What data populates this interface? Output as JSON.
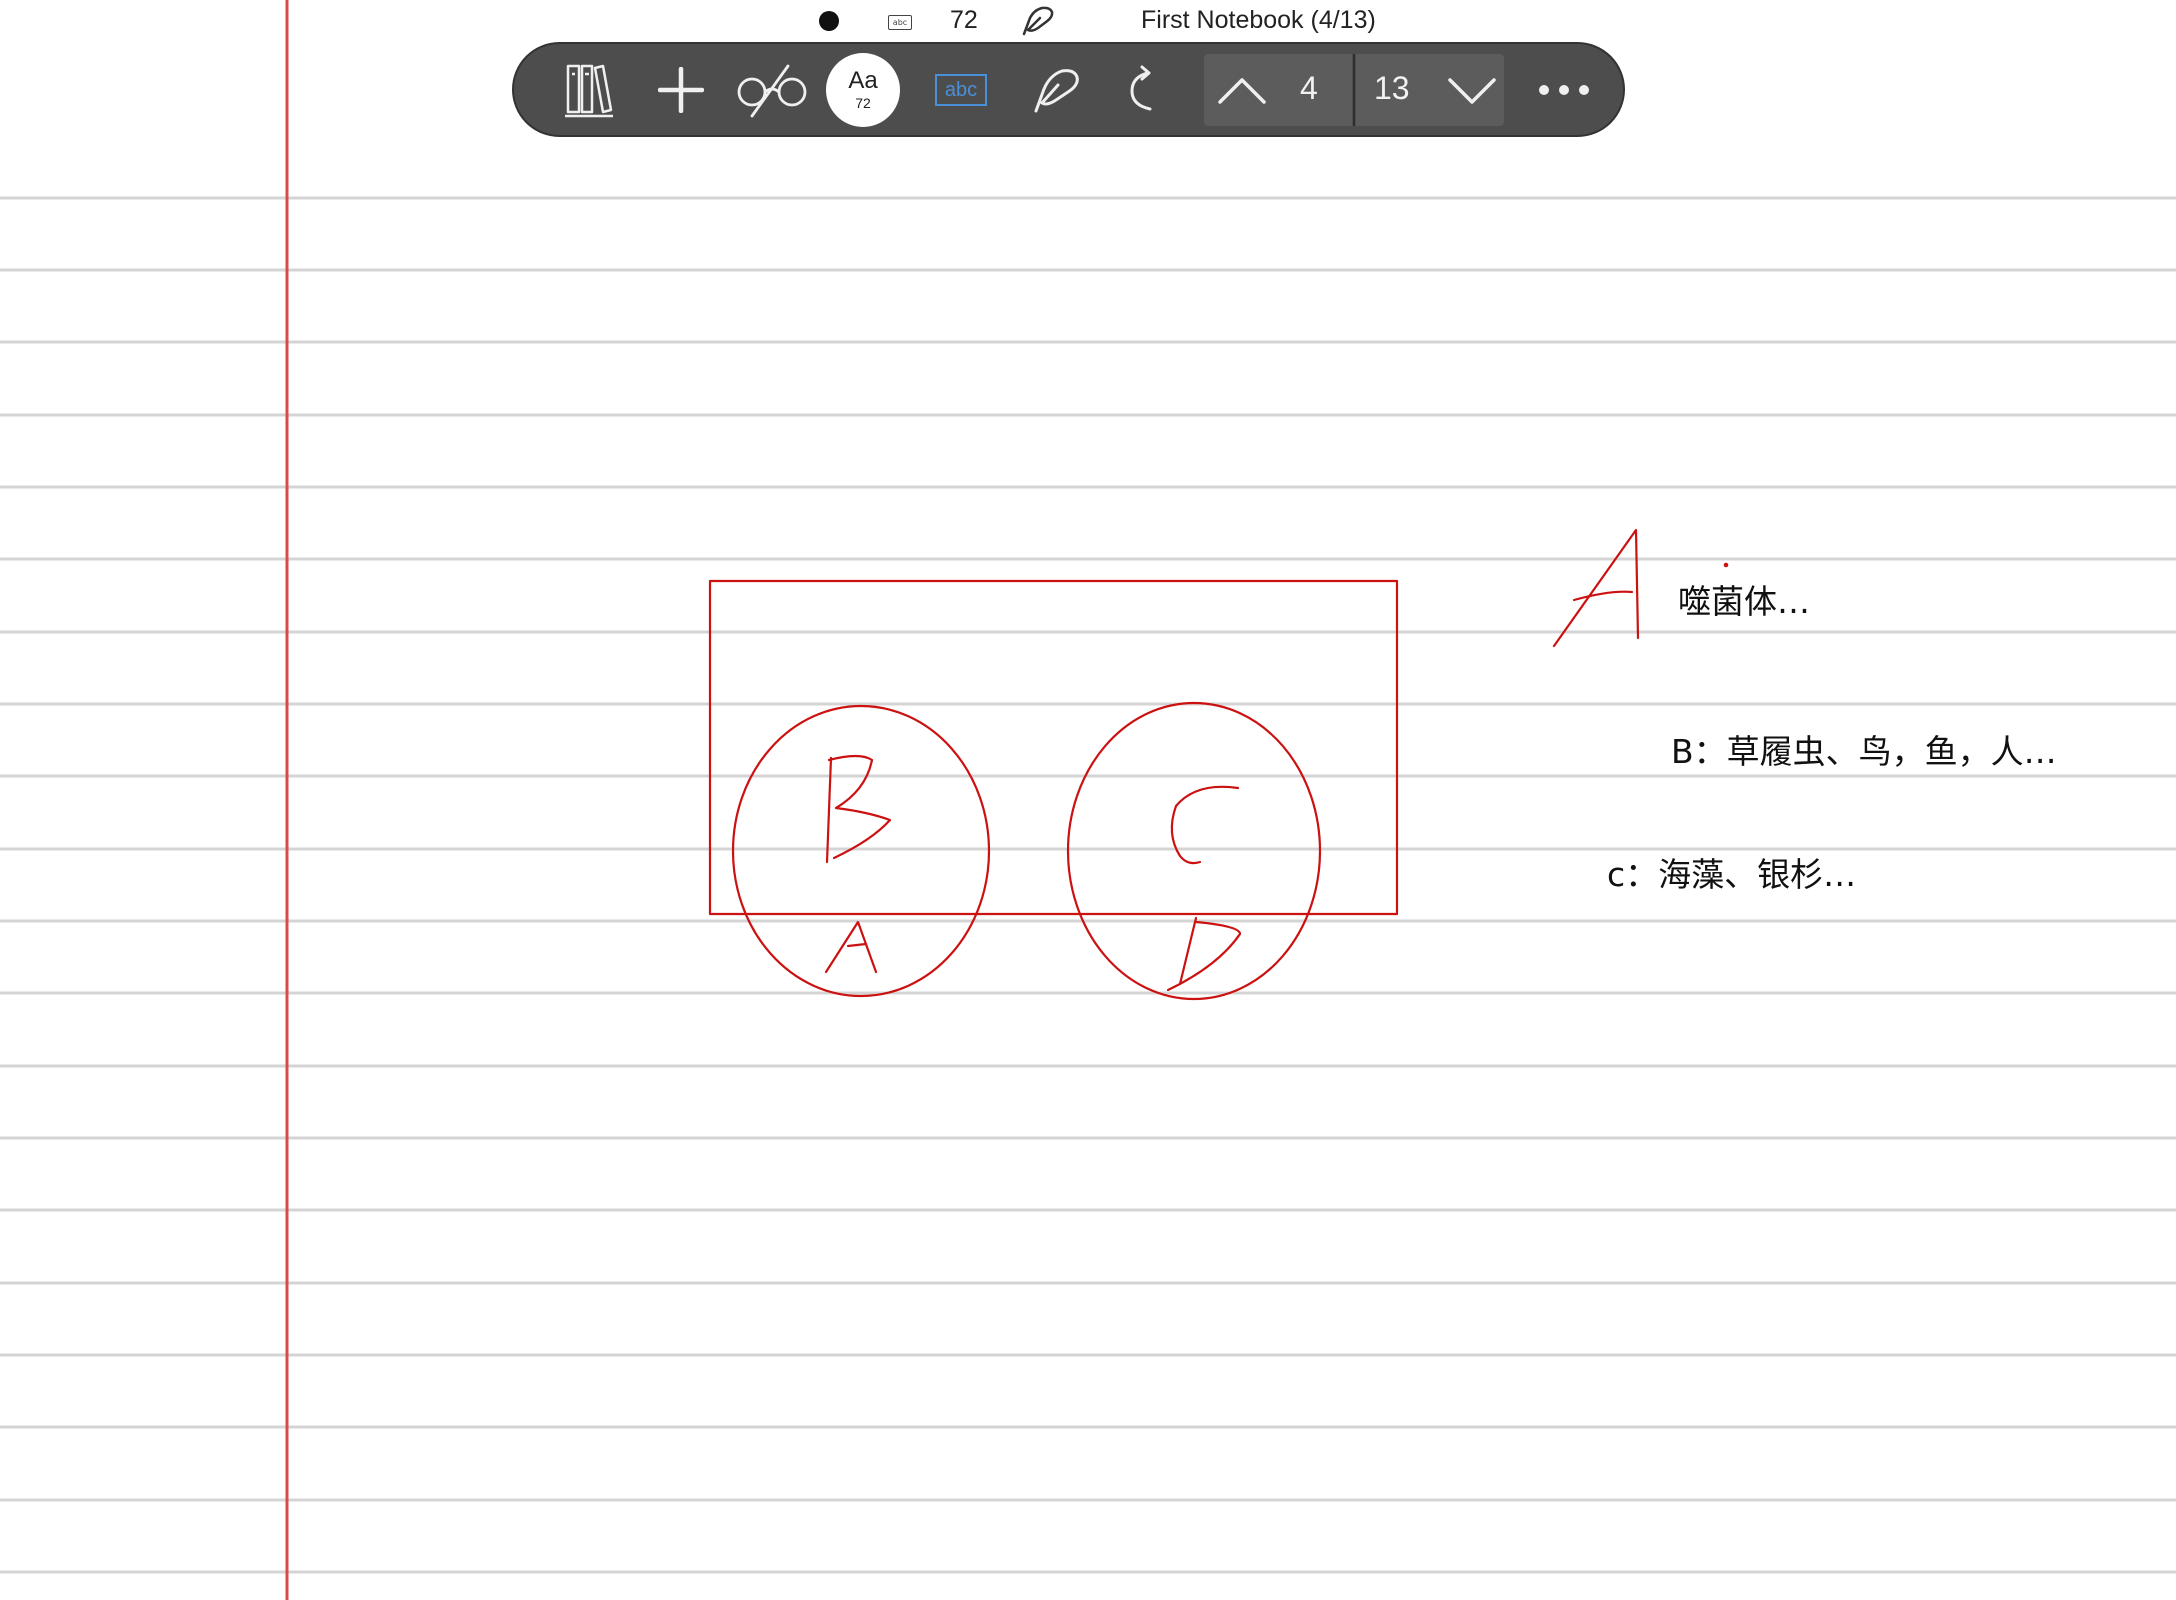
{
  "status_bar": {
    "font_size": "72",
    "notebook_title": "First Notebook (4/13)"
  },
  "toolbar": {
    "font_button": {
      "label": "Aa",
      "size": "72"
    },
    "text_tool_label": "abc",
    "page_current": "4",
    "page_total": "13"
  },
  "notes": {
    "a_text": "噬菌体…",
    "b_text": "B：草履虫、鸟，鱼，人…",
    "c_text": "c：海藻、银杉…"
  },
  "sketch": {
    "ink_color": "#cc1111",
    "handwritten_letters": [
      "A",
      "B",
      "C",
      "D",
      "A"
    ]
  },
  "colors": {
    "margin_line": "#d94a4a",
    "ruled_line": "#d4d4d4",
    "toolbar_bg": "#4d4d4d",
    "text_tool_accent": "#4a90d9"
  },
  "icons": {
    "library": "library-icon",
    "add": "plus-icon",
    "reader": "glasses-icon",
    "pen": "pen-icon",
    "redo": "redo-icon",
    "prev_page": "chevron-up-icon",
    "next_page": "chevron-down-icon",
    "more": "more-icon"
  }
}
